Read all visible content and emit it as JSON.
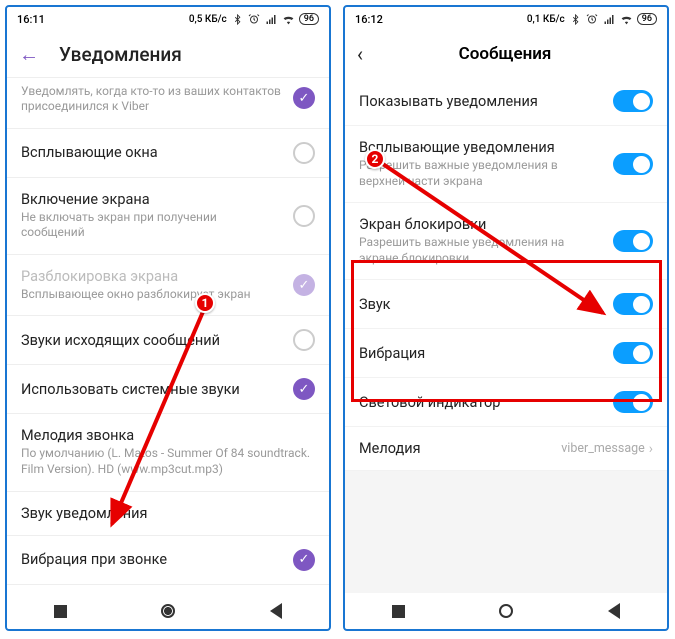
{
  "left": {
    "status": {
      "time": "16:11",
      "kb": "0,5 КБ/с",
      "battery": "96"
    },
    "header": {
      "title": "Уведомления"
    },
    "items": [
      {
        "title": "",
        "sub": "Уведомлять, когда кто-то из ваших контактов присоединился к Viber",
        "checked": true
      },
      {
        "title": "Всплывающие окна",
        "checked": false
      },
      {
        "title": "Включение экрана",
        "sub": "Не включать экран при получении сообщений",
        "checked": false
      },
      {
        "title": "Разблокировка экрана",
        "sub": "Всплывающее окно разблокирует экран",
        "checked": true,
        "faded": true,
        "disabled": true
      },
      {
        "title": "Звуки исходящих сообщений",
        "checked": false
      },
      {
        "title": "Использовать системные звуки",
        "checked": true
      },
      {
        "title": "Мелодия звонка",
        "sub": "По умолчанию (L. Matos - Summer Of 84 soundtrack. Film Version). HD (www.mp3cut.mp3)"
      },
      {
        "title": "Звук уведомления"
      },
      {
        "title": "Вибрация при звонке",
        "checked": true
      }
    ]
  },
  "right": {
    "status": {
      "time": "16:12",
      "kb": "0,1 КБ/с",
      "battery": "96"
    },
    "header": {
      "title": "Сообщения"
    },
    "items": [
      {
        "title": "Показывать уведомления",
        "on": true
      },
      {
        "title": "Всплывающие уведомления",
        "sub": "Разрешить важные уведомления в верхней части экрана",
        "on": true
      },
      {
        "title": "Экран блокировки",
        "sub": "Разрешить важные уведомления на экране блокировки",
        "on": true
      },
      {
        "title": "Звук",
        "on": true
      },
      {
        "title": "Вибрация",
        "on": true
      },
      {
        "title": "Световой индикатор",
        "on": true
      },
      {
        "title": "Мелодия",
        "value": "viber_message"
      }
    ]
  },
  "markers": {
    "m1": "1",
    "m2": "2"
  }
}
